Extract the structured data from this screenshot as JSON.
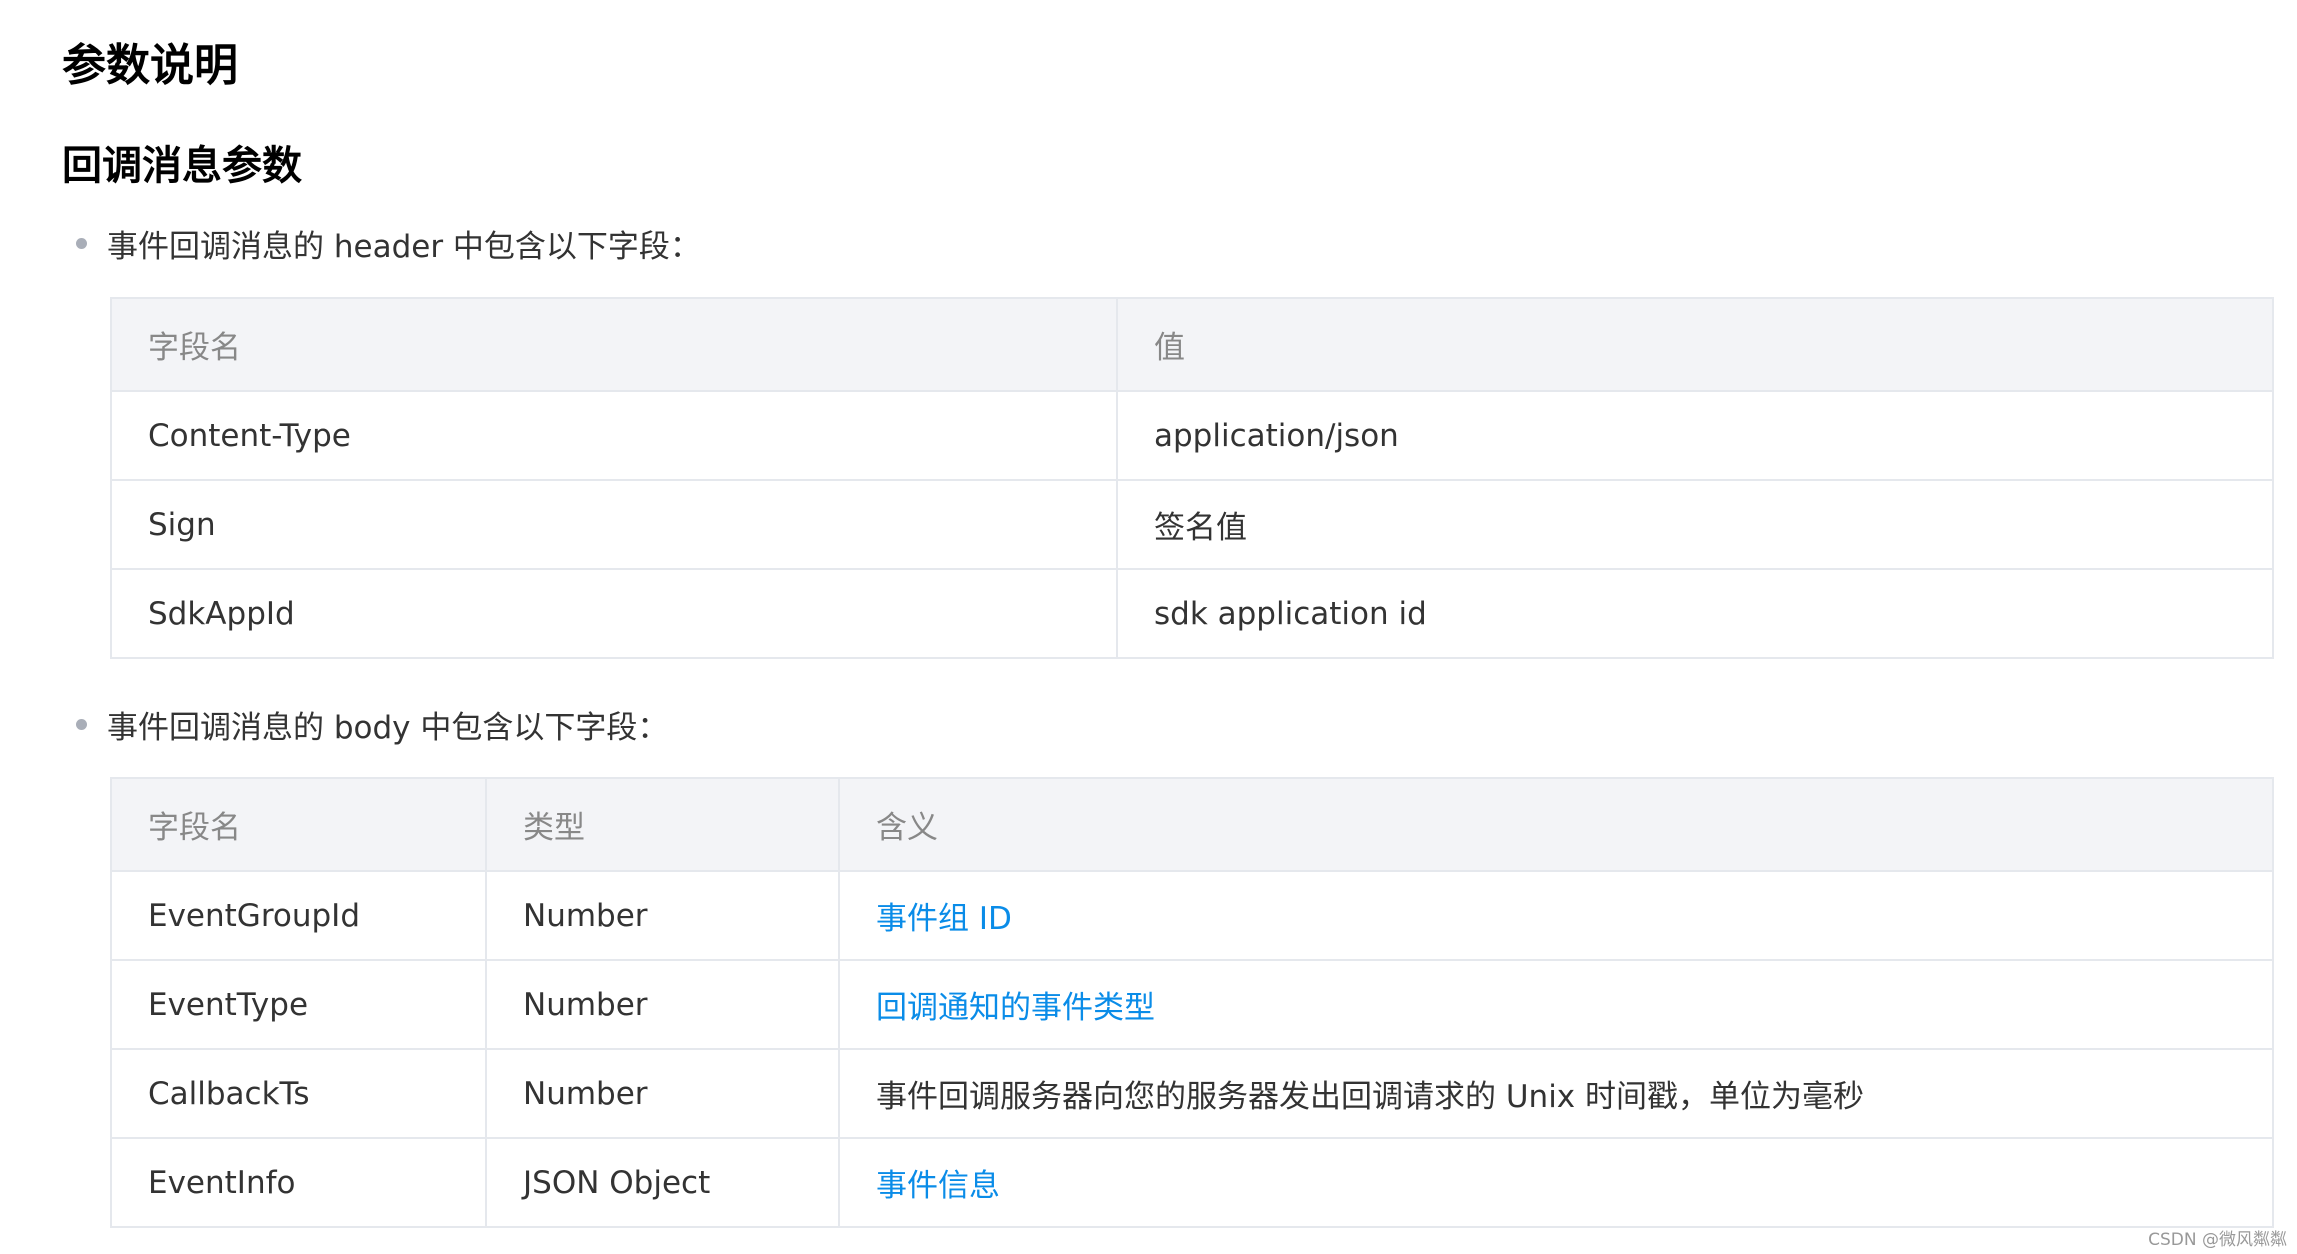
{
  "page": {
    "title": "参数说明",
    "section_title": "回调消息参数"
  },
  "header_section": {
    "intro": "事件回调消息的 header 中包含以下字段：",
    "columns": [
      "字段名",
      "值"
    ],
    "rows": [
      [
        "Content-Type",
        "application/json"
      ],
      [
        "Sign",
        "签名值"
      ],
      [
        "SdkAppId",
        "sdk application id"
      ]
    ]
  },
  "body_section": {
    "intro": "事件回调消息的 body 中包含以下字段：",
    "columns": [
      "字段名",
      "类型",
      "含义"
    ],
    "rows": [
      [
        "EventGroupId",
        "Number",
        "事件组 ID"
      ],
      [
        "EventType",
        "Number",
        "回调通知的事件类型"
      ],
      [
        "CallbackTs",
        "Number",
        "事件回调服务器向您的服务器发出回调请求的 Unix 时间戳，单位为毫秒"
      ],
      [
        "EventInfo",
        "JSON Object",
        "事件信息"
      ]
    ]
  },
  "watermark": "CSDN @微风粼粼",
  "colors": {
    "link": "#0a8ce8",
    "header_bg": "#f3f4f7",
    "border": "#e5e8ed"
  }
}
